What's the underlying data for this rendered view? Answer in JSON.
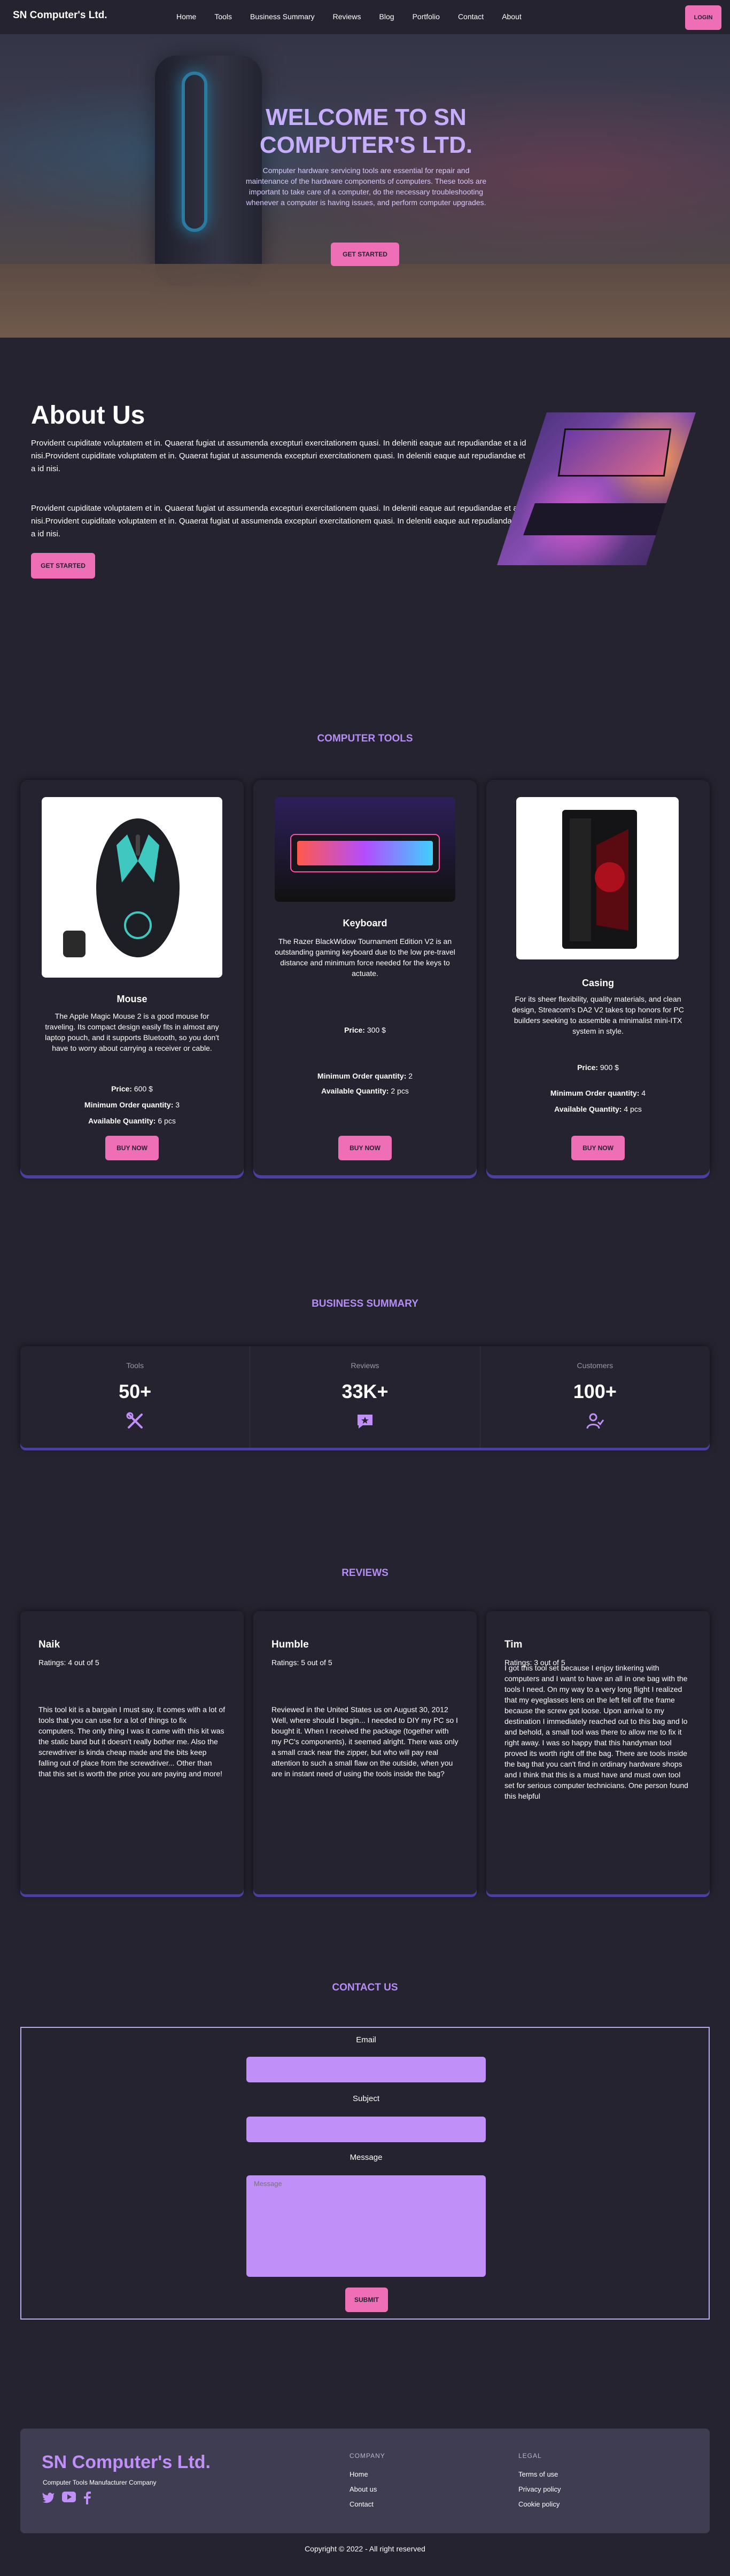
{
  "nav": {
    "brand": "SN Computer's Ltd.",
    "links": [
      "Home",
      "Tools",
      "Business Summary",
      "Reviews",
      "Blog",
      "Portfolio",
      "Contact",
      "About"
    ],
    "login": "LOGIN"
  },
  "hero": {
    "title": "WELCOME TO SN COMPUTER'S LTD.",
    "text": "Computer hardware servicing tools are essential for repair and maintenance of the hardware components of computers. These tools are important to take care of a computer, do the necessary troubleshooting whenever a computer is having issues, and perform computer upgrades.",
    "button": "GET STARTED"
  },
  "about": {
    "title": "About Us",
    "p1": "Provident cupiditate voluptatem et in. Quaerat fugiat ut assumenda excepturi exercitationem quasi. In deleniti eaque aut repudiandae et a id nisi.Provident cupiditate voluptatem et in. Quaerat fugiat ut assumenda excepturi exercitationem quasi. In deleniti eaque aut repudiandae et a id nisi.",
    "p2": "Provident cupiditate voluptatem et in. Quaerat fugiat ut assumenda excepturi exercitationem quasi. In deleniti eaque aut repudiandae et a id nisi.Provident cupiditate voluptatem et in. Quaerat fugiat ut assumenda excepturi exercitationem quasi. In deleniti eaque aut repudiandae et a id nisi.",
    "button": "GET STARTED"
  },
  "tools": {
    "title": "COMPUTER TOOLS",
    "price_label": "Price:",
    "min_label": "Minimum Order quantity:",
    "avail_label": "Available Quantity:",
    "buy": "BUY NOW",
    "items": [
      {
        "name": "Mouse",
        "desc": "The Apple Magic Mouse 2 is a good mouse for traveling. Its compact design easily fits in almost any laptop pouch, and it supports Bluetooth, so you don't have to worry about carrying a receiver or cable.",
        "price": "600 $",
        "min": "3",
        "avail": "6 pcs"
      },
      {
        "name": "Keyboard",
        "desc": "The Razer BlackWidow Tournament Edition V2 is an outstanding gaming keyboard due to the low pre-travel distance and minimum force needed for the keys to actuate.",
        "price": "300 $",
        "min": "2",
        "avail": "2 pcs"
      },
      {
        "name": "Casing",
        "desc": "For its sheer flexibility, quality materials, and clean design, Streacom's DA2 V2 takes top honors for PC builders seeking to assemble a minimalist mini-ITX system in style.",
        "price": "900 $",
        "min": "4",
        "avail": "4 pcs"
      }
    ]
  },
  "summary": {
    "title": "BUSINESS SUMMARY",
    "items": [
      {
        "label": "Tools",
        "value": "50+",
        "icon": "tools-icon"
      },
      {
        "label": "Reviews",
        "value": "33K+",
        "icon": "review-chat-icon"
      },
      {
        "label": "Customers",
        "value": "100+",
        "icon": "customers-icon"
      }
    ]
  },
  "reviews": {
    "title": "REVIEWS",
    "items": [
      {
        "name": "Naik",
        "rating": "Ratings: 4 out of 5",
        "text": "This tool kit is a bargain I must say. It comes with a lot of tools that you can use for a lot of things to fix computers. The only thing I was it came with this kit was the static band but it doesn't really bother me. Also the screwdriver is kinda cheap made and the bits keep falling out of place from the screwdriver... Other than that this set is worth the price you are paying and more!"
      },
      {
        "name": "Humble",
        "rating": "Ratings: 5 out of 5",
        "text": "Reviewed in the United States us on August 30, 2012 Well, where should I begin... I needed to DIY my PC so I bought it. When I received the package (together with my PC's components), it seemed alright. There was only a small crack near the zipper, but who will pay real attention to such a small flaw on the outside, when you are in instant need of using the tools inside the bag?"
      },
      {
        "name": "Tim",
        "rating": "Ratings: 3 out of 5",
        "text": "I got this tool set because I enjoy tinkering with computers and I want to have an all in one bag with the tools I need. On my way to a very long flight I realized that my eyeglasses lens on the left fell off the frame because the screw got loose. Upon arrival to my destination I immediately reached out to this bag and lo and behold, a small tool was there to allow me to fix it right away. I was so happy that this handyman tool proved its worth right off the bag. There are tools inside the bag that you can't find in ordinary hardware shops and I think that this is a must have and must own tool set for serious computer technicians. One person found this helpful"
      }
    ]
  },
  "contact": {
    "title": "CONTACT US",
    "email_label": "Email",
    "subject_label": "Subject",
    "message_label": "Message",
    "message_placeholder": "Message",
    "submit": "SUBMIT"
  },
  "footer": {
    "brand": "SN Computer's Ltd.",
    "tagline": "Computer Tools Manufacturer Company",
    "company_title": "COMPANY",
    "company_links": [
      "Home",
      "About us",
      "Contact"
    ],
    "legal_title": "LEGAL",
    "legal_links": [
      "Terms of use",
      "Privacy policy",
      "Cookie policy"
    ],
    "copyright": "Copyright © 2022 - All right reserved"
  },
  "colors": {
    "accent": "#ee6fb6",
    "purple": "#b58df5",
    "bg": "#24232f"
  }
}
